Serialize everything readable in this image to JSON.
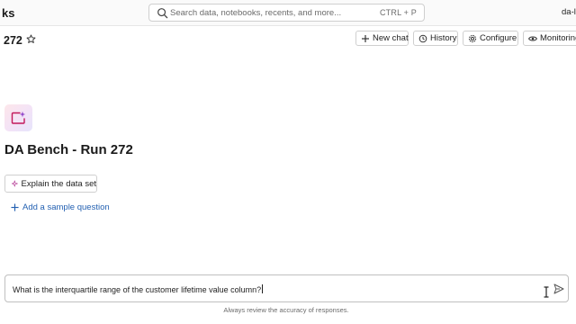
{
  "header": {
    "brand": "ks",
    "search": {
      "placeholder": "Search data, notebooks, recents, and more...",
      "shortcut": "CTRL + P",
      "icon": "search-icon"
    },
    "workspace": "da-l"
  },
  "page": {
    "title": "272",
    "favorite_icon": "star-icon"
  },
  "toolbar": {
    "new_chat": "New chat",
    "history": "History",
    "configure": "Configure",
    "monitoring": "Monitoring"
  },
  "space": {
    "logo_icon": "genie-sparkle-icon",
    "title": "DA Bench - Run 272",
    "explain_button": "Explain the data set",
    "add_sample_question": "Add a sample question"
  },
  "composer": {
    "value": "What is the interquartile range of the customer lifetime value column?",
    "send_icon": "send-icon"
  },
  "footer": {
    "disclaimer": "Always review the accuracy of responses."
  },
  "colors": {
    "link": "#2461b2",
    "border": "#cfcfcf",
    "logo_accent": "#c2185b"
  }
}
